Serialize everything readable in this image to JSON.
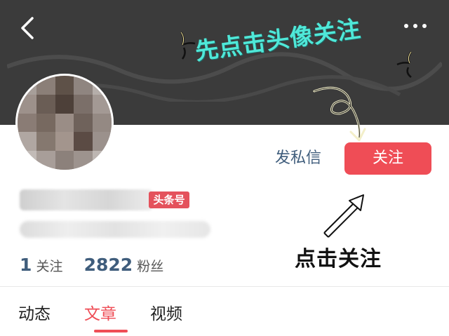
{
  "header": {
    "annotation_top": "先点击头像关注",
    "colors": {
      "background": "#3b3b3b",
      "annotation": "#4fe8d8"
    },
    "icons": {
      "back": "back-arrow-icon",
      "more": "more-dots-icon"
    }
  },
  "profile": {
    "avatar": "blurred-avatar",
    "badge_text": "头条号",
    "actions": {
      "message_label": "发私信",
      "follow_label": "关注",
      "follow_color": "#ef4d56"
    },
    "stats": {
      "following_count": "1",
      "following_label": "关注",
      "followers_count": "2822",
      "followers_label": "粉丝"
    }
  },
  "annotation_bottom": "点击关注",
  "tabs": [
    {
      "label": "动态"
    },
    {
      "label": "文章",
      "active": true
    },
    {
      "label": "视频"
    }
  ]
}
